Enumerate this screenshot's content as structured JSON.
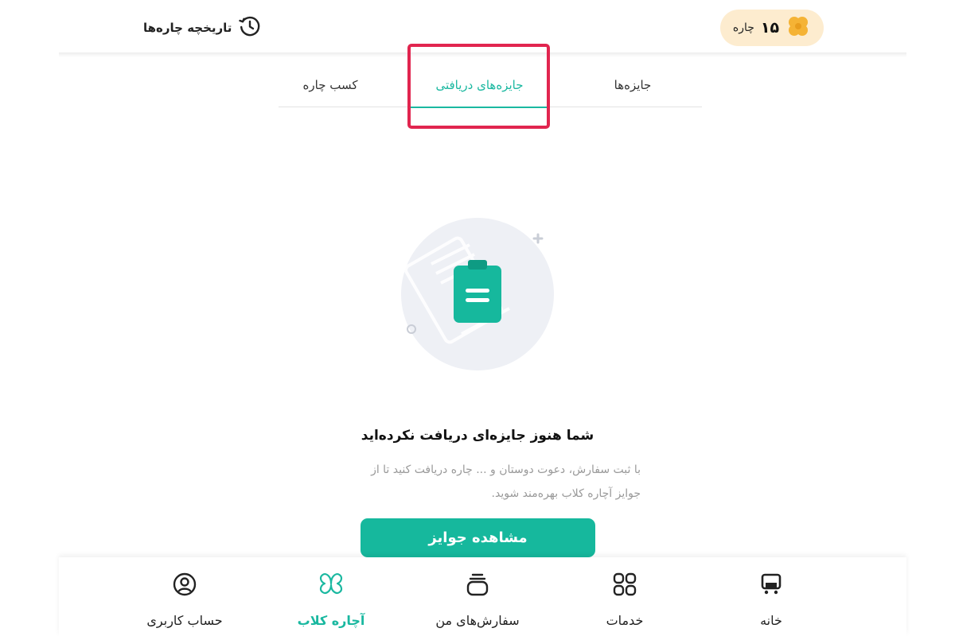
{
  "header": {
    "history_label": "تاریخچه چاره‌ها",
    "balance_value": "۱۵",
    "balance_unit": "چاره"
  },
  "tabs": [
    {
      "label": "کسب چاره",
      "active": false
    },
    {
      "label": "جایزه‌های دریافتی",
      "active": true
    },
    {
      "label": "جایزه‌ها",
      "active": false
    }
  ],
  "empty_state": {
    "title": "شما هنوز جایزه‌ای دریافت نکرده‌اید",
    "description": "با ثبت سفارش، دعوت دوستان و ... چاره دریافت کنید تا از جوایز آچاره کلاب بهره‌مند شوید.",
    "button_label": "مشاهده جوایز"
  },
  "bottom_nav": [
    {
      "label": "حساب کاربری",
      "icon": "user-circle-icon",
      "active": false
    },
    {
      "label": "آچاره کلاب",
      "icon": "clover-icon",
      "active": true
    },
    {
      "label": "سفارش‌های من",
      "icon": "orders-icon",
      "active": false
    },
    {
      "label": "خدمات",
      "icon": "grid-icon",
      "active": false
    },
    {
      "label": "خانه",
      "icon": "home-icon",
      "active": false
    }
  ],
  "colors": {
    "accent": "#1ab8a0",
    "button": "#16b89d",
    "highlight": "#e1254f",
    "pill_bg": "#fdeccf",
    "clover": "#f5b335"
  }
}
